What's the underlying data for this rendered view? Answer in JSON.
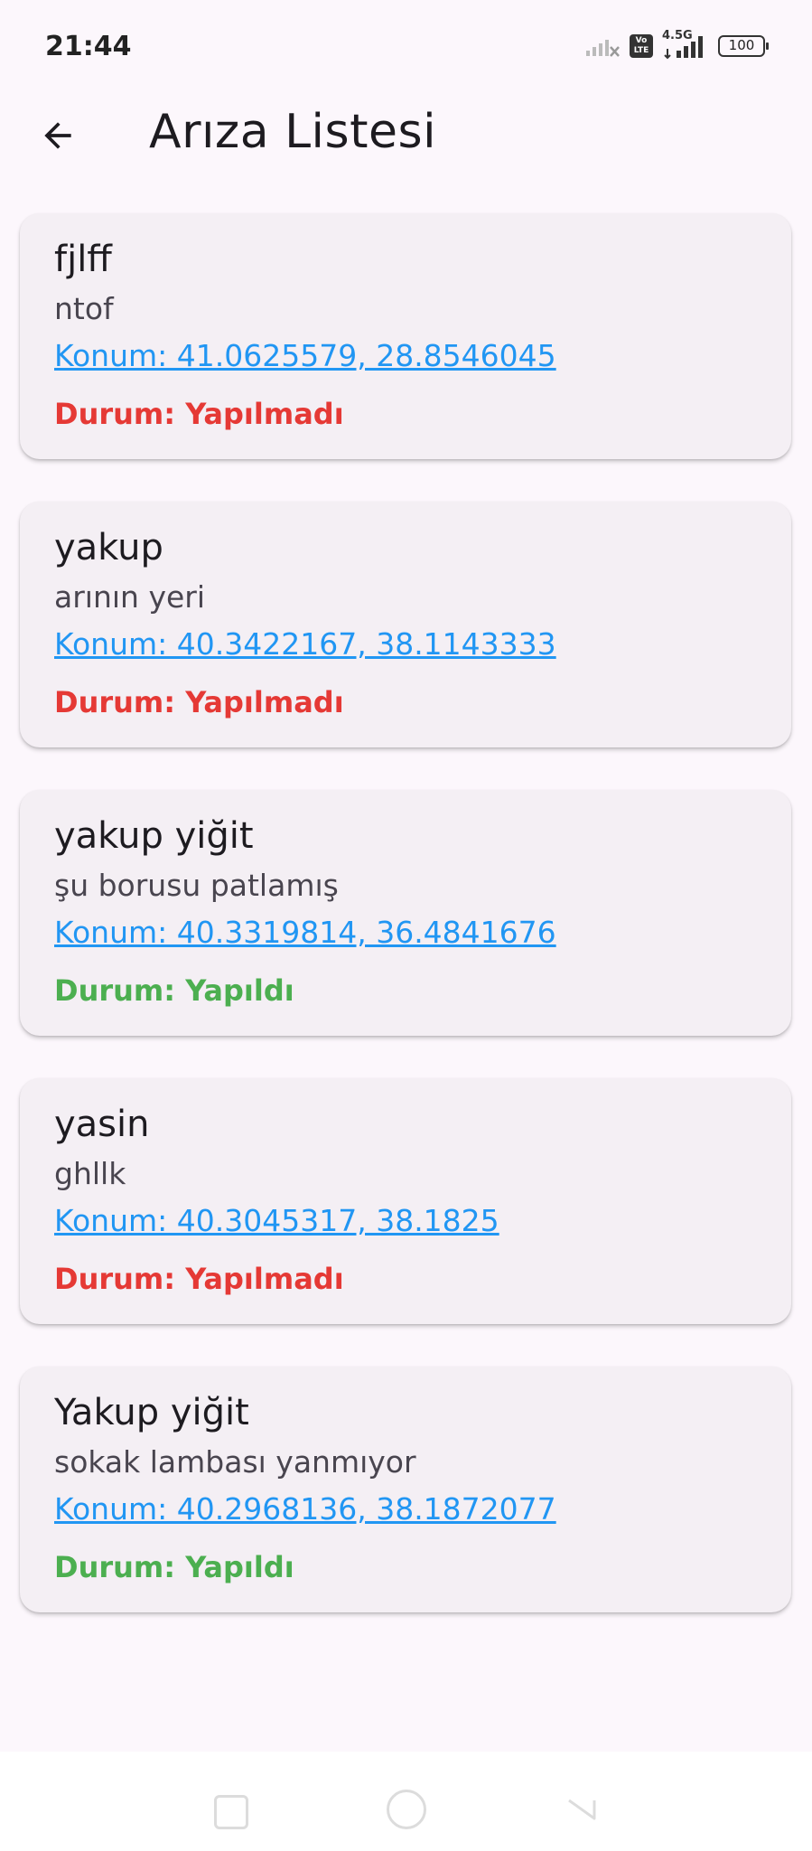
{
  "status_bar": {
    "time": "21:44",
    "network": "4.5G",
    "volte": "Vo LTE",
    "battery": "100"
  },
  "app_bar": {
    "title": "Arıza Listesi",
    "back_icon": "arrow-back-icon"
  },
  "faults": [
    {
      "title": "fjlff",
      "description": "ntof",
      "location": "Konum: 41.0625579, 28.8546045",
      "status": "Durum: Yapılmadı",
      "done": false
    },
    {
      "title": "yakup",
      "description": "arının yeri",
      "location": "Konum: 40.3422167, 38.1143333",
      "status": "Durum: Yapılmadı",
      "done": false
    },
    {
      "title": "yakup yiğit",
      "description": "şu borusu patlamış",
      "location": "Konum: 40.3319814, 36.4841676",
      "status": "Durum: Yapıldı",
      "done": true
    },
    {
      "title": "yasin",
      "description": "ghllk",
      "location": "Konum: 40.3045317, 38.1825",
      "status": "Durum: Yapılmadı",
      "done": false
    },
    {
      "title": "Yakup yiğit",
      "description": "sokak lambası yanmıyor",
      "location": "Konum: 40.2968136, 38.1872077",
      "status": "Durum: Yapıldı",
      "done": true
    }
  ],
  "colors": {
    "status_not_done": "#e53935",
    "status_done": "#4caf50",
    "link": "#2196f3"
  }
}
